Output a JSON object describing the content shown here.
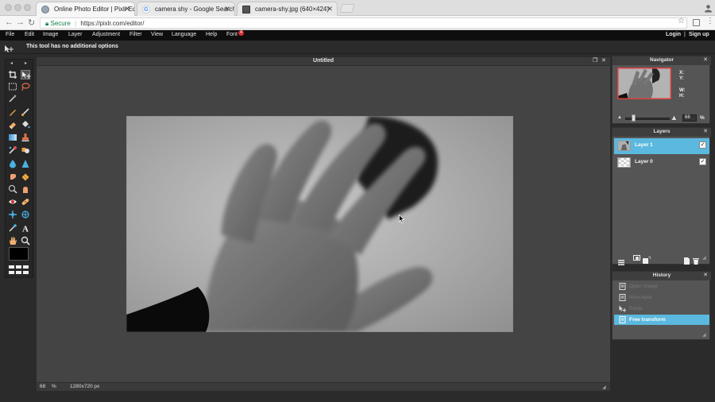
{
  "browser": {
    "tabs": [
      {
        "title": "Online Photo Editor | Pixlr Edit",
        "active": true
      },
      {
        "title": "camera shy - Google Search",
        "active": false
      },
      {
        "title": "camera-shy.jpg (640×424)",
        "active": false
      }
    ],
    "secure_label": "Secure",
    "url": "https://pixlr.com/editor/"
  },
  "menu": {
    "items": [
      "File",
      "Edit",
      "Image",
      "Layer",
      "Adjustment",
      "Filter",
      "View",
      "Language",
      "Help",
      "Font"
    ],
    "font_badge": "4",
    "login": "Login",
    "divider": "|",
    "signup": "Sign up"
  },
  "options_bar": {
    "message": "This tool has no additional options"
  },
  "toolbox": {
    "tools": [
      "crop-icon",
      "move-icon",
      "marquee-icon",
      "lasso-icon",
      "wand-icon",
      "pencil-icon",
      "brush-icon",
      "eraser-icon",
      "bucket-icon",
      "gradient-icon",
      "clone-stamp-icon",
      "color-replace-icon",
      "drawing-icon",
      "blur-icon",
      "sharpen-icon",
      "smudge-icon",
      "sponge-icon",
      "dodge-icon",
      "burn-icon",
      "red-eye-icon",
      "spot-heal-icon",
      "bloat-icon",
      "pinch-icon",
      "colorpicker-icon",
      "type-icon",
      "hand-icon",
      "zoom-icon"
    ]
  },
  "document": {
    "title": "Untitled",
    "zoom": "68",
    "zoom_unit": "%",
    "dimensions": "1280x720 px"
  },
  "navigator": {
    "title": "Navigator",
    "x_label": "X:",
    "y_label": "Y:",
    "w_label": "W:",
    "h_label": "H:",
    "zoom": "68",
    "zoom_unit": "%"
  },
  "layers": {
    "title": "Layers",
    "items": [
      {
        "name": "Layer 1",
        "selected": true,
        "visible": true
      },
      {
        "name": "Layer 0",
        "selected": false,
        "visible": true
      }
    ]
  },
  "history": {
    "title": "History",
    "items": [
      {
        "label": "Open Image",
        "active": false
      },
      {
        "label": "New layer",
        "active": false
      },
      {
        "label": "Paste",
        "active": false
      },
      {
        "label": "Free transform",
        "active": true
      }
    ]
  },
  "colors": {
    "accent": "#5bb8de",
    "menubar": "#0e0e0e",
    "panel_bg": "#555555"
  }
}
